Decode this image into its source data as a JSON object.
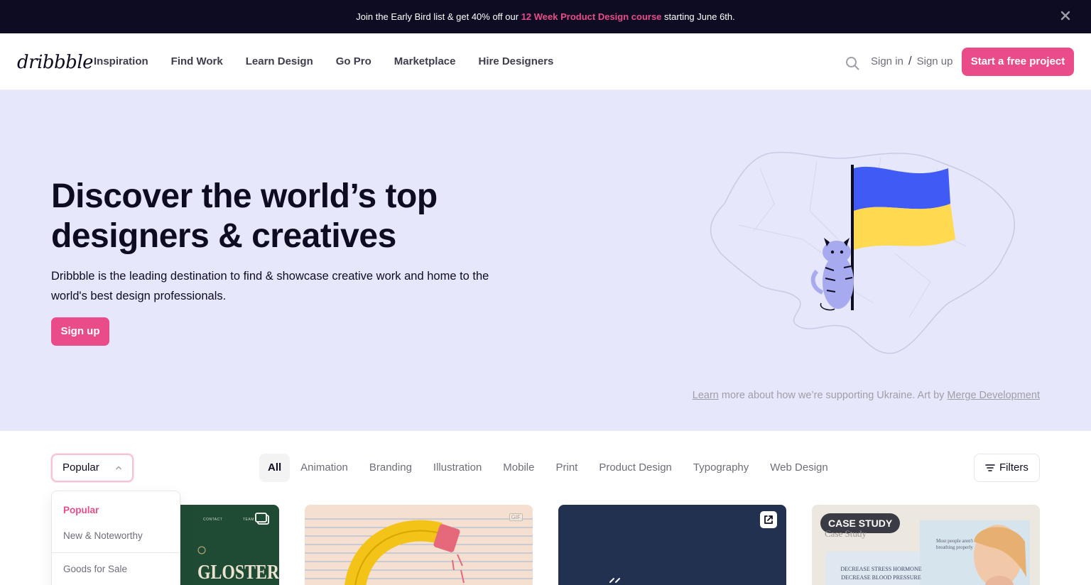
{
  "banner": {
    "text_before": "Join the Early Bird list & get 40% off our ",
    "link_text": "12 Week Product Design course",
    "text_after": " starting June 6th.",
    "close_icon": "close-icon"
  },
  "header": {
    "logo": "dribbble",
    "nav": [
      "Inspiration",
      "Find Work",
      "Learn Design",
      "Go Pro",
      "Marketplace",
      "Hire Designers"
    ],
    "search_icon": "search-icon",
    "sign_in": "Sign in",
    "separator": "/",
    "sign_up": "Sign up",
    "cta": "Start a free project"
  },
  "hero": {
    "title": "Discover the world’s top designers & creatives",
    "description": "Dribbble is the leading destination to find & showcase creative work and home to the world's best design professionals.",
    "signup": "Sign up",
    "credit": {
      "learn": "Learn",
      "middle": " more about how we’re supporting Ukraine. Art by ",
      "artist": "Merge Development"
    }
  },
  "filters": {
    "sort_value": "Popular",
    "categories": [
      "All",
      "Animation",
      "Branding",
      "Illustration",
      "Mobile",
      "Print",
      "Product Design",
      "Typography",
      "Web Design"
    ],
    "active_category": "All",
    "filters_label": "Filters"
  },
  "dropdown": {
    "options": [
      "Popular",
      "New & Noteworthy",
      "Goods for Sale"
    ],
    "selected": "Popular"
  },
  "shots": {
    "shot1": {
      "title": "GLOSTER",
      "nav": [
        "CONTACT",
        "TEAM"
      ]
    },
    "shot2": {
      "badge": "GIF"
    },
    "shot4": {
      "badge": "CASE STUDY",
      "subtitle": "Case Study",
      "text": "DECREASE STRESS HORMONE DECREASE BLOOD PRESSURE",
      "quote": "Most people aren't breathing properly"
    }
  },
  "colors": {
    "brand_pink": "#ea4c89",
    "banner_bg": "#0d0c22",
    "hero_bg": "#e7e7fb",
    "flag_blue": "#3f5af5",
    "flag_yellow": "#ffd94f"
  }
}
